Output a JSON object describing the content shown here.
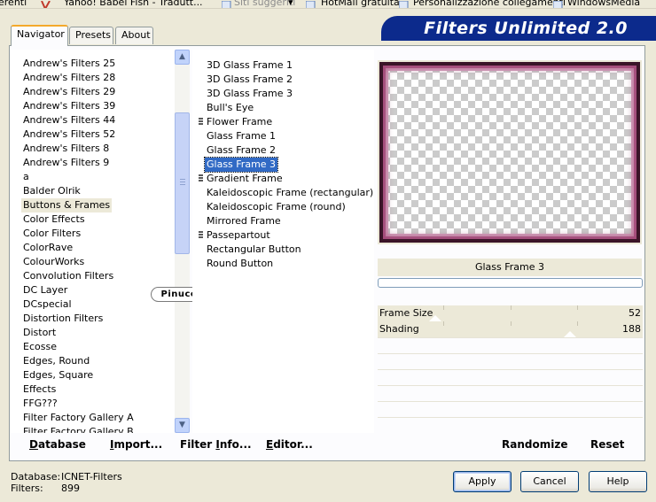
{
  "browser_toolbar": {
    "items": [
      "erenti",
      "Yahoo! Babel Fish - Tradutt...",
      "Siti suggeriti",
      "HotMail gratuita",
      "Personalizzazione collegamenti",
      "WindowsMedia"
    ]
  },
  "app": {
    "title": "Filters Unlimited 2.0"
  },
  "tabs": [
    {
      "label": "Navigator",
      "active": true
    },
    {
      "label": "Presets",
      "active": false
    },
    {
      "label": "About",
      "active": false
    }
  ],
  "categories": {
    "items": [
      "Andrew's Filters 25",
      "Andrew's Filters 28",
      "Andrew's Filters 29",
      "Andrew's Filters 39",
      "Andrew's Filters 44",
      "Andrew's Filters 52",
      "Andrew's Filters 8",
      "Andrew's Filters 9",
      "a",
      "Balder Olrik",
      "Buttons & Frames",
      "Color Effects",
      "Color Filters",
      "ColorRave",
      "ColourWorks",
      "Convolution Filters",
      "DC Layer",
      "DCspecial",
      "Distortion Filters",
      "Distort",
      "Ecosse",
      "Edges, Round",
      "Edges, Square",
      "Effects",
      "FFG???",
      "Filter Factory Gallery A",
      "Filter Factory Gallery B"
    ],
    "selected": "Buttons & Frames"
  },
  "logo": {
    "text": "Pinuccia"
  },
  "filters": {
    "items": [
      {
        "label": "3D Glass Frame 1",
        "mark": false
      },
      {
        "label": "3D Glass Frame 2",
        "mark": false
      },
      {
        "label": "3D Glass Frame 3",
        "mark": false
      },
      {
        "label": "Bull's Eye",
        "mark": false
      },
      {
        "label": "Flower Frame",
        "mark": true
      },
      {
        "label": "Glass Frame 1",
        "mark": false
      },
      {
        "label": "Glass Frame 2",
        "mark": false
      },
      {
        "label": "Glass Frame 3",
        "mark": false
      },
      {
        "label": "Gradient Frame",
        "mark": true
      },
      {
        "label": "Kaleidoscopic Frame (rectangular)",
        "mark": false
      },
      {
        "label": "Kaleidoscopic Frame (round)",
        "mark": false
      },
      {
        "label": "Mirrored Frame",
        "mark": false
      },
      {
        "label": "Passepartout",
        "mark": true
      },
      {
        "label": "Rectangular Button",
        "mark": false
      },
      {
        "label": "Round Button",
        "mark": false
      }
    ],
    "selected": "Glass Frame 3"
  },
  "preview": {
    "filter_name": "Glass Frame 3",
    "frame_color": "#3a1428",
    "glow_color": "#b46690"
  },
  "parameters": [
    {
      "label": "Frame Size",
      "value": 52,
      "max": 255
    },
    {
      "label": "Shading",
      "value": 188,
      "max": 255
    }
  ],
  "bottom_buttons": {
    "database": {
      "pre": "",
      "u": "D",
      "post": "atabase"
    },
    "import": {
      "pre": "",
      "u": "I",
      "post": "mport..."
    },
    "filter_info": {
      "pre": "Filter ",
      "u": "I",
      "post": "nfo..."
    },
    "editor": {
      "pre": "",
      "u": "E",
      "post": "ditor..."
    },
    "randomize": "Randomize",
    "reset": "Reset"
  },
  "status": {
    "database_label": "Database:",
    "database_value": "ICNET-Filters",
    "filters_label": "Filters:",
    "filters_value": "899"
  },
  "dialog_buttons": {
    "apply": "Apply",
    "cancel": "Cancel",
    "help": "Help"
  }
}
